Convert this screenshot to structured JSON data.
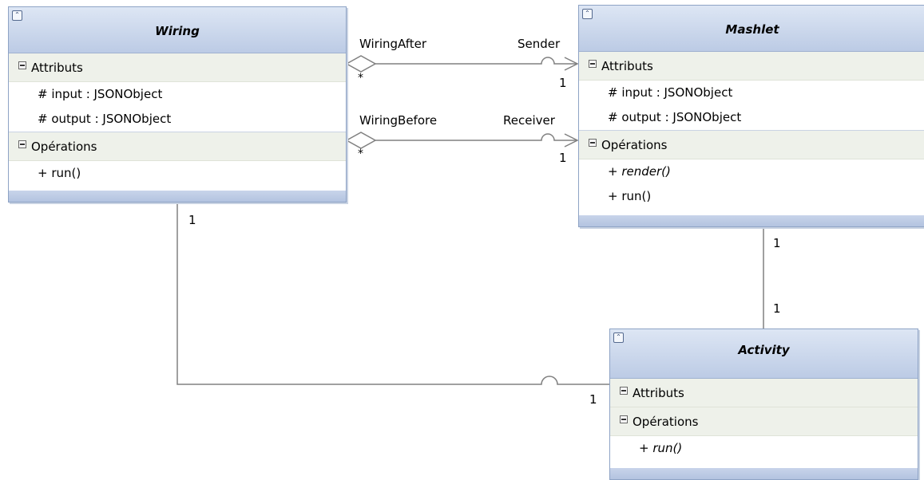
{
  "classes": {
    "wiring": {
      "name": "Wiring",
      "attributes_label": "Attributs",
      "attributes": [
        "# input : JSONObject",
        "# output : JSONObject"
      ],
      "operations_label": "Opérations",
      "operations": [
        "+ run()"
      ]
    },
    "mashlet": {
      "name": "Mashlet",
      "attributes_label": "Attributs",
      "attributes": [
        "# input : JSONObject",
        "# output : JSONObject"
      ],
      "operations_label": "Opérations",
      "operations": [
        "+ render()",
        "+ run()"
      ]
    },
    "activity": {
      "name": "Activity",
      "attributes_label": "Attributs",
      "operations_label": "Opérations",
      "operations": [
        "+ run()"
      ]
    }
  },
  "associations": {
    "wiring_after": {
      "name": "WiringAfter",
      "target_role": "Sender",
      "source_mult": "*",
      "target_mult": "1"
    },
    "wiring_before": {
      "name": "WiringBefore",
      "target_role": "Receiver",
      "source_mult": "*",
      "target_mult": "1"
    },
    "wiring_activity": {
      "source_mult": "1",
      "target_mult": "1"
    },
    "mashlet_activity": {
      "source_mult": "1",
      "target_mult": "1"
    }
  },
  "colors": {
    "header": "#bccbe5",
    "border": "#8ea3c5",
    "section": "#eef1ea",
    "line": "#808080"
  }
}
